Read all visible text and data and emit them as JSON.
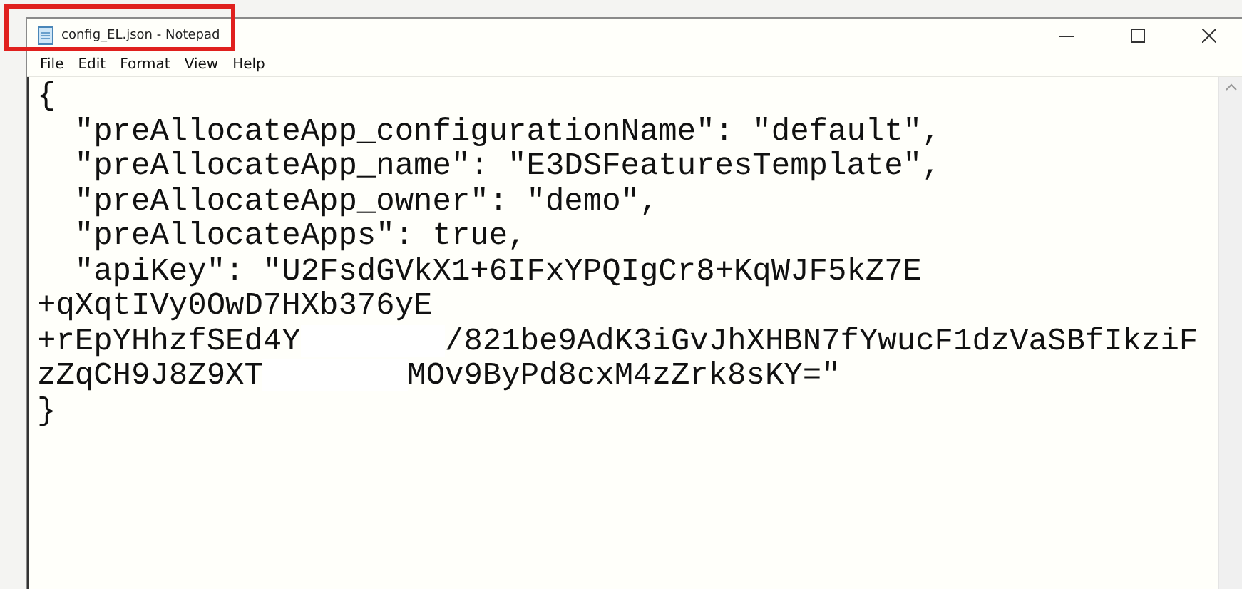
{
  "window": {
    "title": "config_EL.json - Notepad"
  },
  "menu": [
    {
      "label": "File"
    },
    {
      "label": "Edit"
    },
    {
      "label": "Format"
    },
    {
      "label": "View"
    },
    {
      "label": "Help"
    }
  ],
  "editor": {
    "lines": [
      [
        {
          "text": "{"
        }
      ],
      [
        {
          "text": "  \"preAllocateApp_configurationName\": \"default\","
        }
      ],
      [
        {
          "text": "  \"preAllocateApp_name\": \"E3DSFeaturesTemplate\","
        }
      ],
      [
        {
          "text": "  \"preAllocateApp_owner\": \"demo\","
        }
      ],
      [
        {
          "text": "  \"preAllocateApps\": true,"
        }
      ],
      [
        {
          "text": "  \"apiKey\": \"U2FsdGVkX1+6IFxYPQIgCr8+KqWJF5kZ7E"
        }
      ],
      [
        {
          "text": "+qXqtIVy0OwD7HXb376yE"
        }
      ],
      [
        {
          "text": "+rEpYHhzfSEd4Y"
        },
        {
          "kind": "redaction"
        },
        {
          "text": "/821be9AdK3iGvJhXHBN7fYwucF1dzVaSBfIkziF"
        }
      ],
      [
        {
          "text": "zZqCH9J8Z9XT"
        },
        {
          "kind": "redaction"
        },
        {
          "text": "MOv9ByPd8cxM4zZrk8sKY=\""
        }
      ],
      [
        {
          "text": "}"
        }
      ]
    ]
  },
  "annotation": {
    "kind": "highlight",
    "color": "#e0201e"
  }
}
